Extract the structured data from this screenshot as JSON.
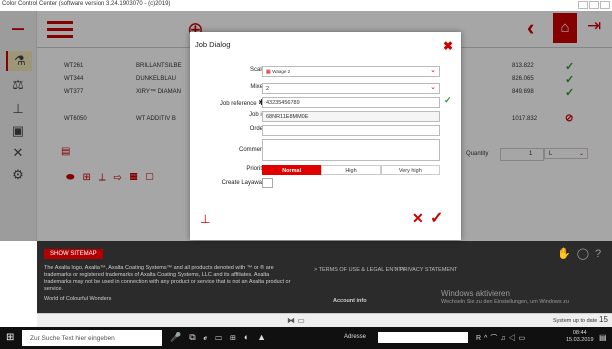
{
  "window": {
    "title": "Color Control Center (software version 3.24.1903070 - (c)2019)"
  },
  "background_table": [
    {
      "code": "WT261",
      "name": "BRILLANTSILBE",
      "value": "813.822"
    },
    {
      "code": "WT344",
      "name": "DUNKELBLAU",
      "value": "826.065"
    },
    {
      "code": "WT377",
      "name": "XIRY™ DIAMAN",
      "value": "849.698"
    },
    {
      "code": "WT6050",
      "name": "WT ADDITIV B",
      "value": "1017.832"
    }
  ],
  "quantity": {
    "label": "Quantity",
    "value": "1",
    "unit": "L"
  },
  "dialog": {
    "title": "Job Dialog",
    "fields": {
      "scale_label": "Scale",
      "scale_value": "Waage 2",
      "mixer_label": "Mixer",
      "mixer_value": "2",
      "job_reference_label": "Job reference",
      "job_reference_value": "43235456789",
      "job_id_label": "Job id",
      "job_id_value": "68NR11E8MM0E",
      "order_label": "Order",
      "order_value": "",
      "comment_label": "Comment",
      "comment_value": "",
      "priority_label": "Priority",
      "priority_options": [
        "Normal",
        "High",
        "Very high"
      ],
      "create_layaway_label": "Create Layaway"
    }
  },
  "footer": {
    "sitemap": "SHOW SITEMAP",
    "legal": "The Axalta logo, Axalta™, Axalta Coating Systems™ and all products denoted with ™ or ® are trademarks or registered trademarks of Axalta Coating Systems, LLC and its affiliates. Axalta trademarks may not be used in connection with any product or service that is not an Axalta product or service.",
    "world": "World of Colourful Wonders",
    "terms": "> TERMS OF USE & LEGAL ENTITY",
    "privacy": "> PRIVACY STATEMENT",
    "account": "Account info",
    "windows_title": "Windows aktivieren",
    "windows_sub": "Wechseln Sie zu den Einstellungen, um Windows zu"
  },
  "statusbar": {
    "system": "System up to date",
    "badge": "15"
  },
  "taskbar": {
    "search_placeholder": "Zur Suche Text hier eingeben",
    "address_label": "Adresse",
    "time": "08:44",
    "date": "15.03.2019"
  }
}
